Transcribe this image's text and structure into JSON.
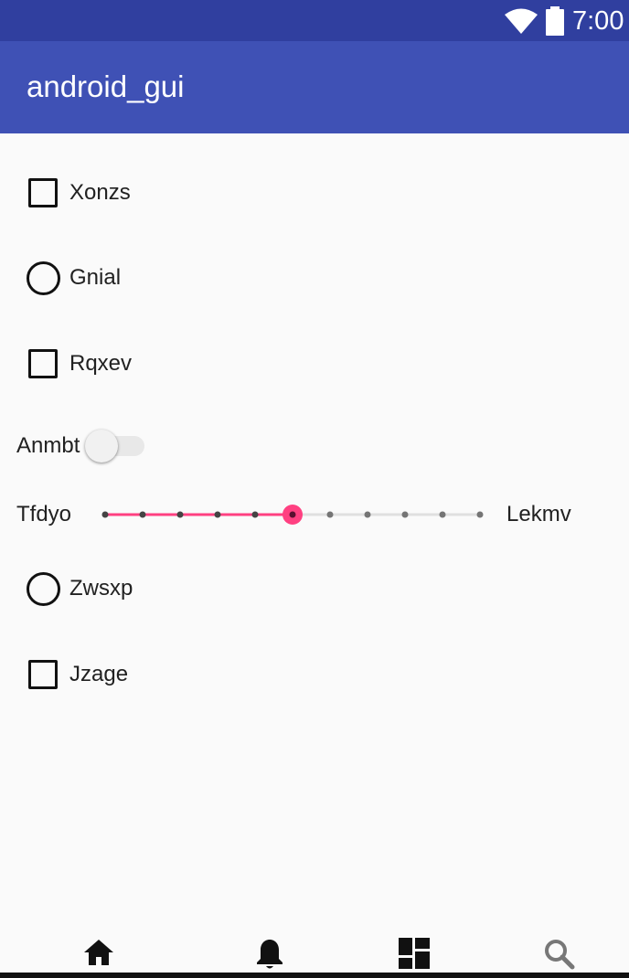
{
  "status_bar": {
    "time": "7:00"
  },
  "app_bar": {
    "title": "android_gui"
  },
  "controls": {
    "checkbox_1": {
      "label": "Xonzs",
      "checked": false
    },
    "radio_1": {
      "label": "Gnial",
      "selected": false
    },
    "checkbox_2": {
      "label": "Rqxev",
      "checked": false
    },
    "switch_1": {
      "label": "Anmbt",
      "on": false
    },
    "seekbar_1": {
      "left_label": "Tfdyo",
      "right_label": "Lekmv",
      "ticks": 11,
      "value": 5,
      "max": 10
    },
    "radio_2": {
      "label": "Zwsxp",
      "selected": false
    },
    "checkbox_3": {
      "label": "Jzage",
      "checked": false
    }
  },
  "colors": {
    "status_bar": "#303f9f",
    "app_bar": "#3f51b5",
    "accent": "#ff4081",
    "background": "#fafafa"
  },
  "bottom_nav": {
    "items": [
      {
        "icon": "home-icon",
        "active": true
      },
      {
        "icon": "bell-icon",
        "active": true
      },
      {
        "icon": "dashboard-icon",
        "active": true
      },
      {
        "icon": "search-icon",
        "active": false
      }
    ]
  }
}
